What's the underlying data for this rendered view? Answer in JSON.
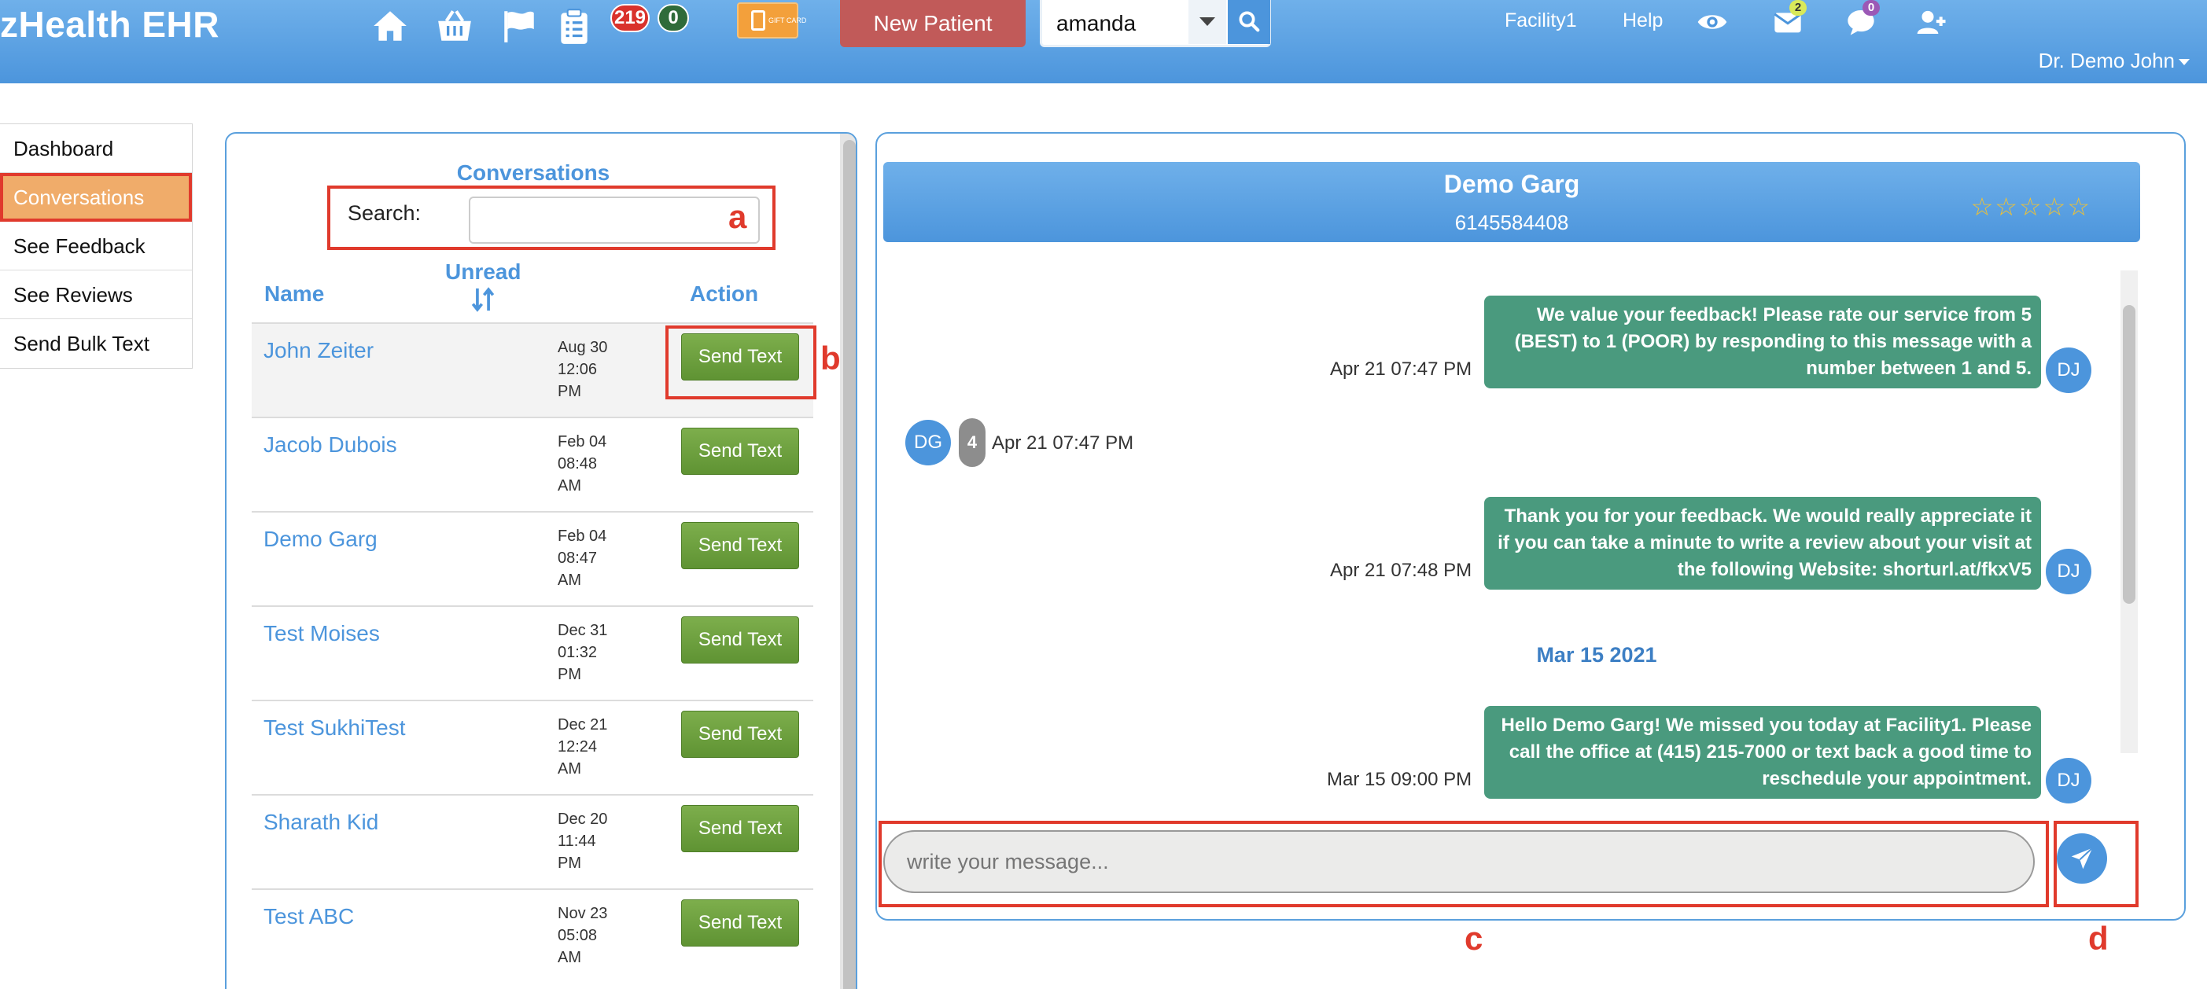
{
  "header": {
    "brand": "zHealth EHR",
    "badge_red": "219",
    "badge_green": "0",
    "gift_card_text": "GIFT CARD",
    "new_patient_label": "New Patient",
    "search_value": "amanda",
    "facility_link": "Facility1",
    "help_link": "Help",
    "mail_badge": "2",
    "chat_badge": "0",
    "user_name": "Dr. Demo John",
    "icons": [
      "home-icon",
      "basket-icon",
      "flag-icon",
      "clipboard-icon",
      "eye-icon",
      "envelope-icon",
      "chat-icon",
      "add-user-icon"
    ]
  },
  "leftnav": {
    "items": [
      "Dashboard",
      "Conversations",
      "See Feedback",
      "See Reviews",
      "Send Bulk Text"
    ],
    "active": "Conversations"
  },
  "conversations": {
    "title": "Conversations",
    "search_label": "Search:",
    "search_value": "",
    "col_name": "Name",
    "col_unread": "Unread",
    "col_action": "Action",
    "rows": [
      {
        "name": "John Zeiter",
        "date": "Aug 30",
        "time": "12:06",
        "ampm": "PM",
        "action": "Send Text"
      },
      {
        "name": "Jacob Dubois",
        "date": "Feb 04",
        "time": "08:48",
        "ampm": "AM",
        "action": "Send Text"
      },
      {
        "name": "Demo Garg",
        "date": "Feb 04",
        "time": "08:47",
        "ampm": "AM",
        "action": "Send Text"
      },
      {
        "name": "Test Moises",
        "date": "Dec 31",
        "time": "01:32",
        "ampm": "PM",
        "action": "Send Text"
      },
      {
        "name": "Test SukhiTest",
        "date": "Dec 21",
        "time": "12:24",
        "ampm": "AM",
        "action": "Send Text"
      },
      {
        "name": "Sharath Kid",
        "date": "Dec 20",
        "time": "11:44",
        "ampm": "PM",
        "action": "Send Text"
      },
      {
        "name": "Test ABC",
        "date": "Nov 23",
        "time": "05:08",
        "ampm": "AM",
        "action": "Send Text"
      }
    ]
  },
  "chat": {
    "contact_name": "Demo Garg",
    "contact_phone": "6145584408",
    "stars": "☆☆☆☆☆",
    "messages": [
      {
        "time": "Apr 21 07:47 PM",
        "lines": [
          "We value your feedback! Please rate our service from 5",
          "(BEST) to 1 (POOR) by responding to this message with a",
          "number between 1 and 5."
        ],
        "avatar": "DJ"
      },
      {
        "time": "Apr 21 07:48 PM",
        "lines": [
          "Thank you for your feedback. We would really appreciate it",
          "if you can take a minute to write a review about your visit at",
          "the following Website: shorturl.at/fkxV5"
        ],
        "avatar": "DJ"
      },
      {
        "time": "Mar 15 09:00 PM",
        "lines": [
          "Hello Demo Garg! We missed you today at Facility1. Please",
          "call the office at (415) 215-7000 or text back a good time to",
          "reschedule your appointment."
        ],
        "avatar": "DJ"
      }
    ],
    "incoming": {
      "avatar": "DG",
      "reply": "4",
      "time": "Apr 21 07:47 PM"
    },
    "date_separator": "Mar 15 2021",
    "compose_placeholder": "write your message..."
  },
  "annotations": {
    "a": "a",
    "b": "b",
    "c": "c",
    "d": "d"
  },
  "colors": {
    "accent": "#4c95dc",
    "bubble": "#4a9a7e",
    "annotation": "#e03a2c",
    "new_patient": "#c15a59",
    "send_button": "#6aa13c"
  }
}
